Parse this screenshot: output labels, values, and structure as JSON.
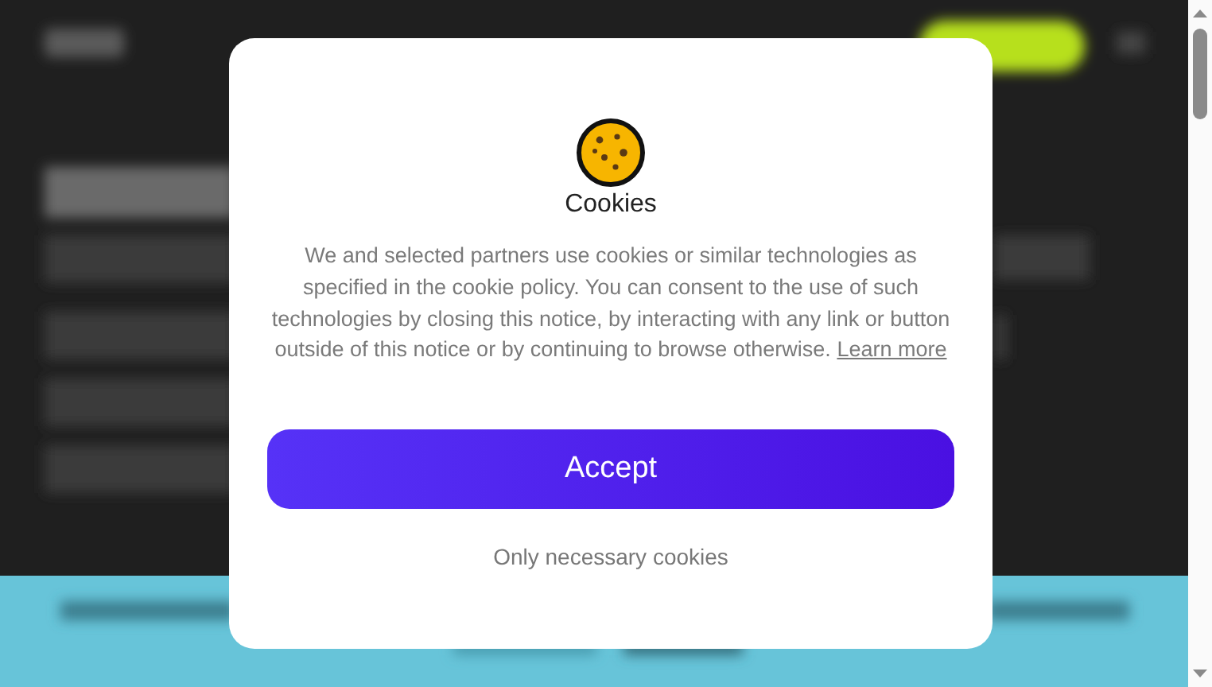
{
  "cookie_dialog": {
    "title": "Cookies",
    "message": "We and selected partners use cookies or similar technologies as specified in the cookie policy. You can consent to the use of such technologies by closing this notice, by interacting with any link or button outside of this notice or by continuing to browse otherwise.",
    "link": "Learn more",
    "buttons": [
      {
        "kind": "primary",
        "label": "Accept"
      },
      {
        "kind": "secondary",
        "label": "Only necessary cookies"
      }
    ]
  }
}
